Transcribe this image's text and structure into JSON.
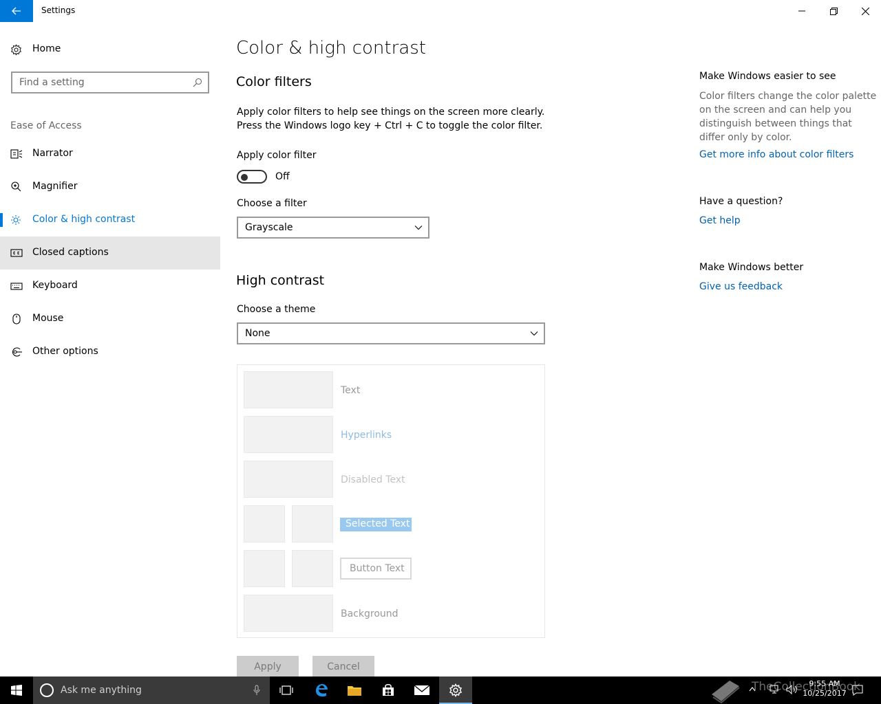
{
  "window": {
    "title": "Settings"
  },
  "sidebar": {
    "home_label": "Home",
    "search_placeholder": "Find a setting",
    "section_label": "Ease of Access",
    "items": [
      {
        "label": "Narrator",
        "icon": "narrator-icon"
      },
      {
        "label": "Magnifier",
        "icon": "magnifier-icon"
      },
      {
        "label": "Color & high contrast",
        "icon": "brightness-icon",
        "active": true
      },
      {
        "label": "Closed captions",
        "icon": "closed-captions-icon",
        "hover": true
      },
      {
        "label": "Keyboard",
        "icon": "keyboard-icon"
      },
      {
        "label": "Mouse",
        "icon": "mouse-icon"
      },
      {
        "label": "Other options",
        "icon": "other-options-icon"
      }
    ]
  },
  "main": {
    "title": "Color & high contrast",
    "color_filters": {
      "heading": "Color filters",
      "description_line1": "Apply color filters to help see things on the screen more clearly.",
      "description_line2": "Press the Windows logo key + Ctrl + C to toggle the color filter.",
      "apply_label": "Apply color filter",
      "toggle_state": "Off",
      "choose_label": "Choose a filter",
      "filter_value": "Grayscale"
    },
    "high_contrast": {
      "heading": "High contrast",
      "choose_label": "Choose a theme",
      "theme_value": "None",
      "preview": {
        "text": "Text",
        "hyperlinks": "Hyperlinks",
        "disabled_text": "Disabled Text",
        "selected_text": "Selected Text",
        "button_text": "Button Text",
        "background": "Background"
      },
      "apply_button": "Apply",
      "cancel_button": "Cancel"
    }
  },
  "right_panel": {
    "easier_heading": "Make Windows easier to see",
    "easier_text": "Color filters change the color palette on the screen and can help you distinguish between things that differ only by color.",
    "easier_link": "Get more info about color filters",
    "question_heading": "Have a question?",
    "question_link": "Get help",
    "better_heading": "Make Windows better",
    "better_link": "Give us feedback"
  },
  "taskbar": {
    "search_text": "Ask me anything",
    "watermark": "TheCollectionBook",
    "time": "9:55 AM",
    "date": "10/25/2017"
  },
  "colors": {
    "accent": "#0078d7",
    "link": "#0063b1",
    "taskbar": "#000000"
  }
}
